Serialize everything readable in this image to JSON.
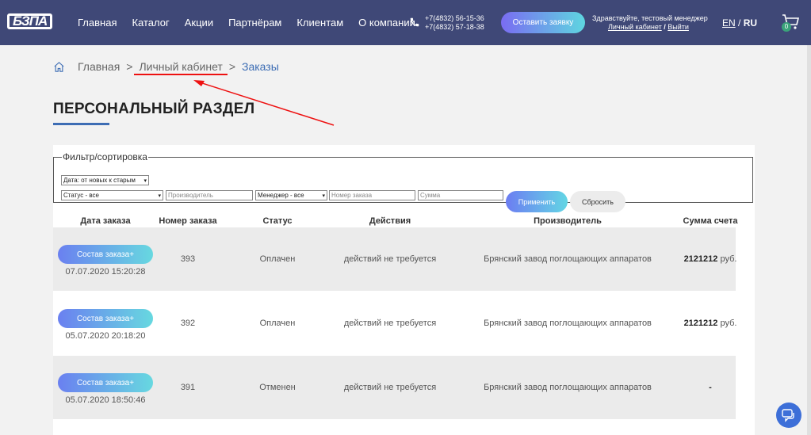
{
  "header": {
    "logo": "БЗПА",
    "nav": [
      "Главная",
      "Каталог",
      "Акции",
      "Партнёрам",
      "Клиентам",
      "О компании"
    ],
    "phones": [
      "+7(4832) 56-15-36",
      "+7(4832) 57-18-38"
    ],
    "request_button": "Оставить заявку",
    "greeting": "Здравствуйте, тестовый менеджер",
    "cabinet_link": "Личный кабинет",
    "links_separator": "/",
    "logout_link": "Выйти",
    "lang_en": "EN",
    "lang_sep": "/",
    "lang_ru": "RU",
    "cart_count": "0"
  },
  "breadcrumb": {
    "home": "Главная",
    "cabinet": "Личный кабинет",
    "current": "Заказы",
    "separator": ">"
  },
  "page_title": "ПЕРСОНАЛЬНЫЙ РАЗДЕЛ",
  "filter": {
    "legend": "Фильтр/сортировка",
    "sort_value": "Дата: от новых к старым",
    "status_value": "Статус - все",
    "manufacturer_placeholder": "Производитель",
    "manager_value": "Менеджер - все",
    "order_number_placeholder": "Номер заказа",
    "sum_placeholder": "Сумма",
    "apply_button": "Применить",
    "reset_button": "Сбросить"
  },
  "table": {
    "headers": [
      "Дата заказа",
      "Номер заказа",
      "Статус",
      "Действия",
      "Производитель",
      "Сумма счета"
    ],
    "order_button": "Состав заказа+",
    "rows": [
      {
        "date": "07.07.2020 15:20:28",
        "number": "393",
        "status": "Оплачен",
        "action": "действий не требуется",
        "manufacturer": "Брянский завод поглощающих аппаратов",
        "sum": "2121212",
        "currency": "руб."
      },
      {
        "date": "05.07.2020 20:18:20",
        "number": "392",
        "status": "Оплачен",
        "action": "действий не требуется",
        "manufacturer": "Брянский завод поглощающих аппаратов",
        "sum": "2121212",
        "currency": "руб."
      },
      {
        "date": "05.07.2020 18:50:46",
        "number": "391",
        "status": "Отменен",
        "action": "действий не требуется",
        "manufacturer": "Брянский завод поглощающих аппаратов",
        "sum": "-",
        "currency": ""
      }
    ]
  },
  "colors": {
    "header_bg": "#3f4877",
    "accent": "#3d6db4",
    "annotation": "#e11111"
  },
  "icons": [
    "home-icon",
    "phone-icon",
    "cart-icon",
    "chat-icon",
    "chevron-down-icon"
  ]
}
